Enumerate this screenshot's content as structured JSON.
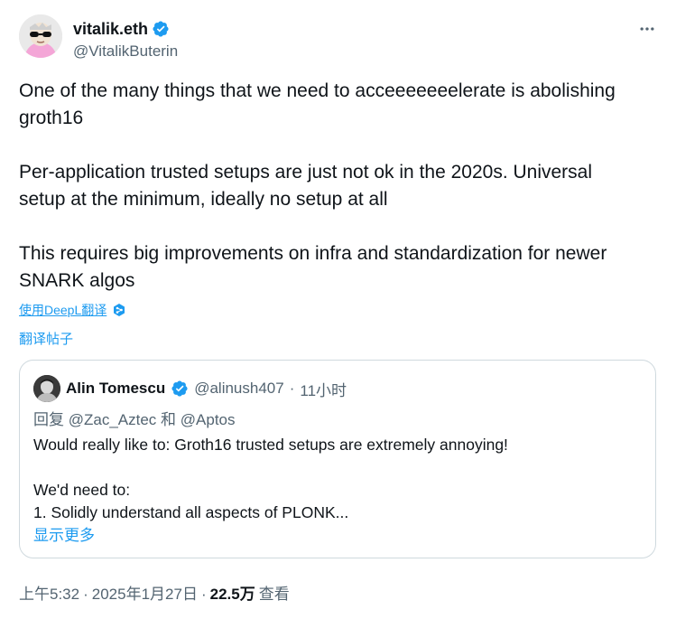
{
  "author": {
    "display_name": "vitalik.eth",
    "handle": "@VitalikButerin",
    "verified": true
  },
  "tweet": {
    "paragraphs": [
      "One of the many things that we need to acceeeeeeelerate is abolishing\ngroth16",
      "Per-application trusted setups are just not ok in the 2020s. Universal\nsetup at the minimum, ideally no setup at all",
      "This requires big improvements on infra and standardization for newer\nSNARK algos"
    ],
    "translate_label": "使用DeepL翻译",
    "translate_post_label": "翻译帖子"
  },
  "quote": {
    "name": "Alin Tomescu",
    "handle": "@alinush407",
    "separator": "·",
    "time": "11小时",
    "reply_prefix": "回复",
    "mention1": "@Zac_Aztec",
    "reply_and": "和",
    "mention2": "@Aptos",
    "text": "Would really like to: Groth16 trusted setups are extremely annoying!\n\nWe'd need to:\n1. Solidly understand all aspects of PLONK...",
    "show_more": "显示更多"
  },
  "meta": {
    "time": "上午5:32",
    "dot1": "·",
    "date": "2025年1月27日",
    "dot2": "·",
    "views": "22.5万",
    "views_label": "查看"
  },
  "icons": {
    "verified": "verified-badge-icon",
    "more": "more-dots-icon",
    "deepl": "deepl-icon"
  },
  "colors": {
    "accent": "#1d9bf0",
    "text": "#0f1419",
    "muted": "#536471",
    "border": "#cfd9de"
  }
}
